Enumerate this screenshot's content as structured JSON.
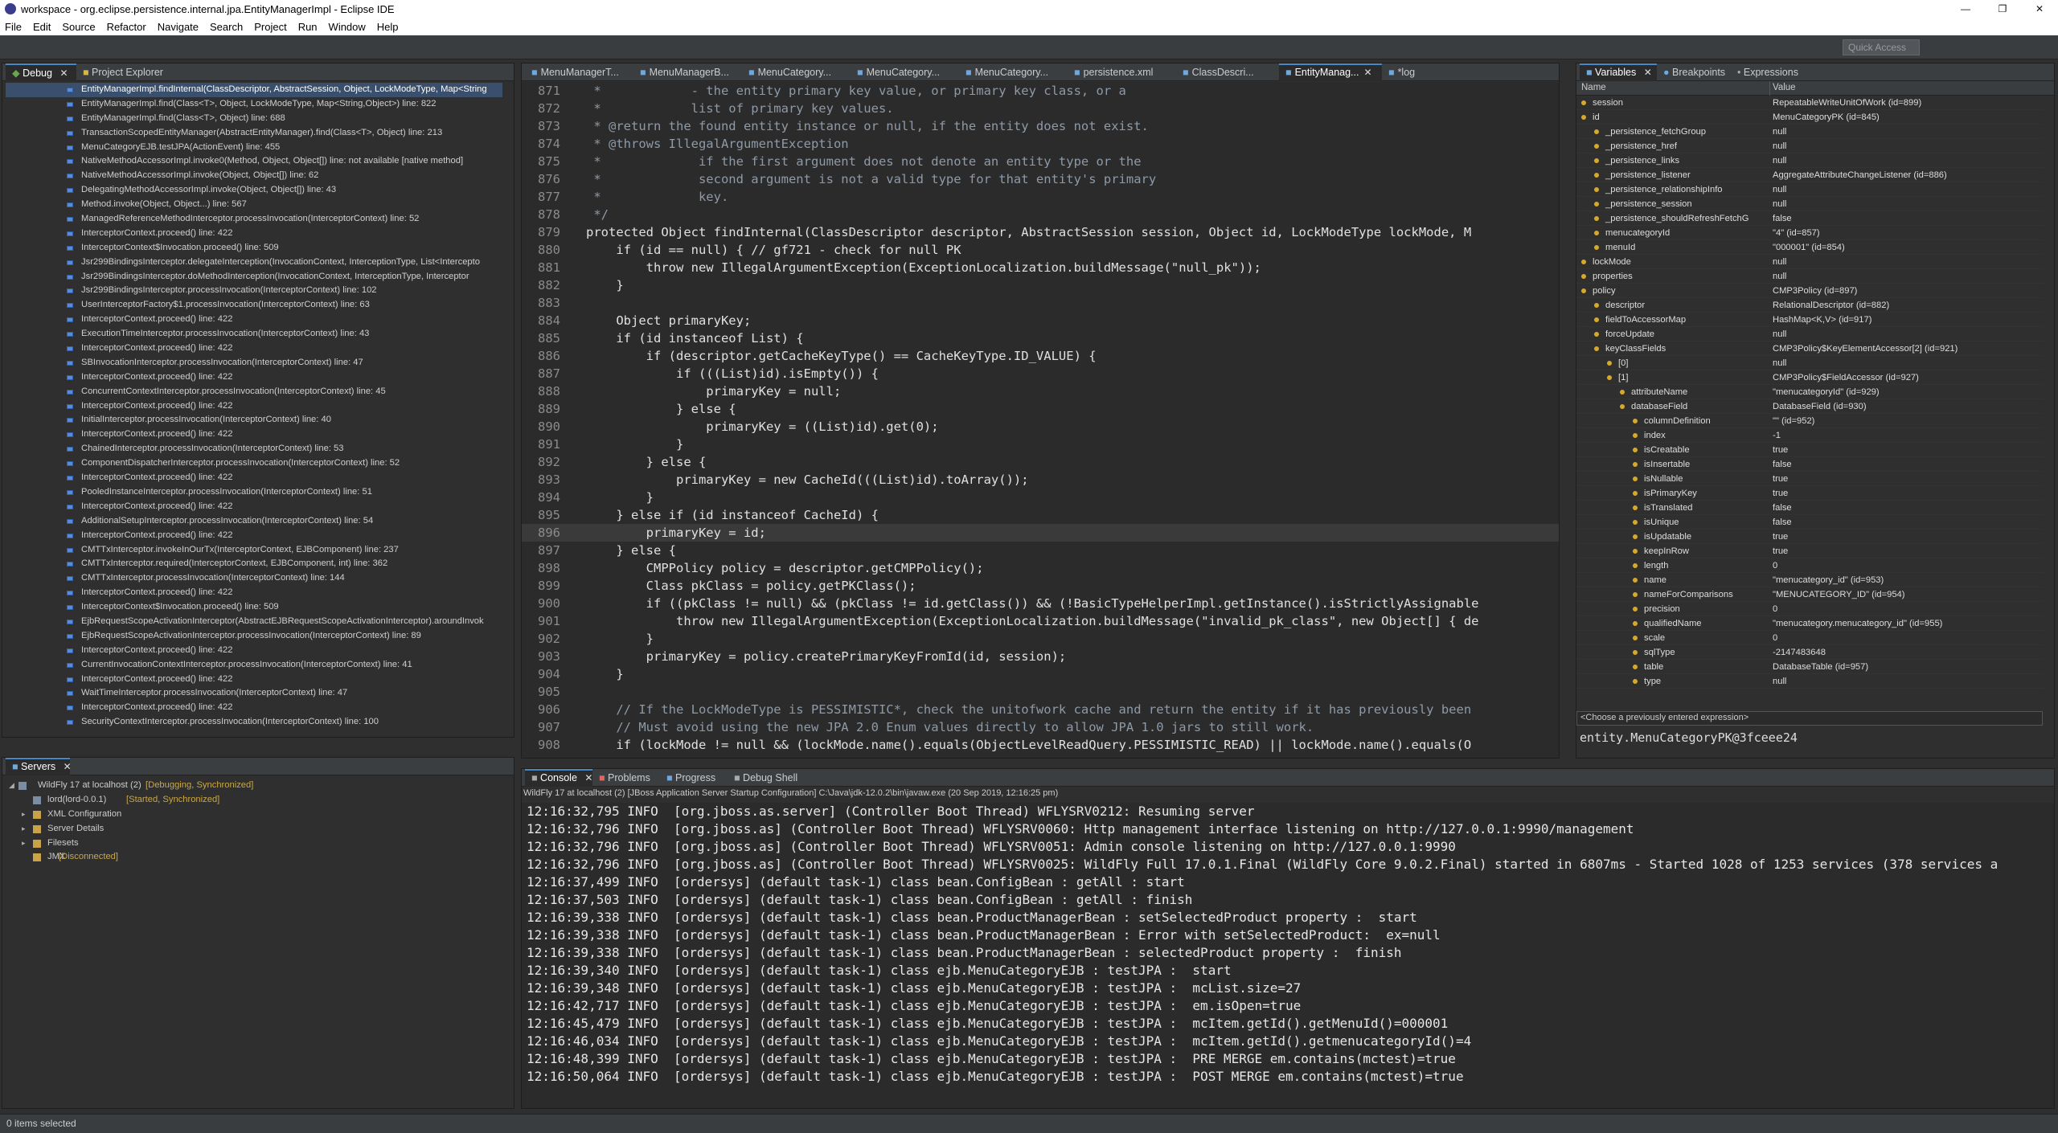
{
  "window": {
    "title": "workspace - org.eclipse.persistence.internal.jpa.EntityManagerImpl - Eclipse IDE"
  },
  "menu": [
    "File",
    "Edit",
    "Source",
    "Refactor",
    "Navigate",
    "Search",
    "Project",
    "Run",
    "Window",
    "Help"
  ],
  "quick_access": "Quick Access",
  "debug_panel": {
    "tabs": [
      "Debug",
      "Project Explorer"
    ],
    "frames": [
      "EntityManagerImpl.findInternal(ClassDescriptor, AbstractSession, Object, LockModeType, Map<String",
      "EntityManagerImpl.find(Class<T>, Object, LockModeType, Map<String,Object>) line: 822",
      "EntityManagerImpl.find(Class<T>, Object) line: 688",
      "TransactionScopedEntityManager(AbstractEntityManager).find(Class<T>, Object) line: 213",
      "MenuCategoryEJB.testJPA(ActionEvent) line: 455",
      "NativeMethodAccessorImpl.invoke0(Method, Object, Object[]) line: not available [native method]",
      "NativeMethodAccessorImpl.invoke(Object, Object[]) line: 62",
      "DelegatingMethodAccessorImpl.invoke(Object, Object[]) line: 43",
      "Method.invoke(Object, Object...) line: 567",
      "ManagedReferenceMethodInterceptor.processInvocation(InterceptorContext) line: 52",
      "InterceptorContext.proceed() line: 422",
      "InterceptorContext$Invocation.proceed() line: 509",
      "Jsr299BindingsInterceptor.delegateInterception(InvocationContext, InterceptionType, List<Intercepto",
      "Jsr299BindingsInterceptor.doMethodInterception(InvocationContext, InterceptionType, Interceptor",
      "Jsr299BindingsInterceptor.processInvocation(InterceptorContext) line: 102",
      "UserInterceptorFactory$1.processInvocation(InterceptorContext) line: 63",
      "InterceptorContext.proceed() line: 422",
      "ExecutionTimeInterceptor.processInvocation(InterceptorContext) line: 43",
      "InterceptorContext.proceed() line: 422",
      "SBInvocationInterceptor.processInvocation(InterceptorContext) line: 47",
      "InterceptorContext.proceed() line: 422",
      "ConcurrentContextInterceptor.processInvocation(InterceptorContext) line: 45",
      "InterceptorContext.proceed() line: 422",
      "InitialInterceptor.processInvocation(InterceptorContext) line: 40",
      "InterceptorContext.proceed() line: 422",
      "ChainedInterceptor.processInvocation(InterceptorContext) line: 53",
      "ComponentDispatcherInterceptor.processInvocation(InterceptorContext) line: 52",
      "InterceptorContext.proceed() line: 422",
      "PooledInstanceInterceptor.processInvocation(InterceptorContext) line: 51",
      "InterceptorContext.proceed() line: 422",
      "AdditionalSetupInterceptor.processInvocation(InterceptorContext) line: 54",
      "InterceptorContext.proceed() line: 422",
      "CMTTxInterceptor.invokeInOurTx(InterceptorContext, EJBComponent) line: 237",
      "CMTTxInterceptor.required(InterceptorContext, EJBComponent, int) line: 362",
      "CMTTxInterceptor.processInvocation(InterceptorContext) line: 144",
      "InterceptorContext.proceed() line: 422",
      "InterceptorContext$Invocation.proceed() line: 509",
      "EjbRequestScopeActivationInterceptor(AbstractEJBRequestScopeActivationInterceptor).aroundInvok",
      "EjbRequestScopeActivationInterceptor.processInvocation(InterceptorContext) line: 89",
      "InterceptorContext.proceed() line: 422",
      "CurrentInvocationContextInterceptor.processInvocation(InterceptorContext) line: 41",
      "InterceptorContext.proceed() line: 422",
      "WaitTimeInterceptor.processInvocation(InterceptorContext) line: 47",
      "InterceptorContext.proceed() line: 422",
      "SecurityContextInterceptor.processInvocation(InterceptorContext) line: 100"
    ]
  },
  "servers_panel": {
    "tab": "Servers",
    "server_name": "WildFly 17 at localhost (2)",
    "server_status": "[Debugging, Synchronized]",
    "nodes": [
      {
        "label": "lord(lord-0.0.1)",
        "status": "[Started, Synchronized]"
      },
      {
        "label": "XML Configuration",
        "status": ""
      },
      {
        "label": "Server Details",
        "status": ""
      },
      {
        "label": "Filesets",
        "status": ""
      },
      {
        "label": "JMX",
        "status": "[Disconnected]"
      }
    ]
  },
  "editor": {
    "tabs": [
      "MenuManagerT...",
      "MenuManagerB...",
      "MenuCategory...",
      "MenuCategory...",
      "MenuCategory...",
      "persistence.xml",
      "ClassDescri...",
      "EntityManag...",
      "*log"
    ],
    "active_tab_index": 7,
    "lines": [
      {
        "n": "871",
        "code": " *            - the entity primary key value, or primary key class, or a",
        "cls": "cmt"
      },
      {
        "n": "872",
        "code": " *            list of primary key values.",
        "cls": "cmt"
      },
      {
        "n": "873",
        "code": " * @return the found entity instance or null, if the entity does not exist.",
        "cls": "cmt"
      },
      {
        "n": "874",
        "code": " * @throws IllegalArgumentException",
        "cls": "cmt"
      },
      {
        "n": "875",
        "code": " *             if the first argument does not denote an entity type or the",
        "cls": "cmt"
      },
      {
        "n": "876",
        "code": " *             second argument is not a valid type for that entity's primary",
        "cls": "cmt"
      },
      {
        "n": "877",
        "code": " *             key.",
        "cls": "cmt"
      },
      {
        "n": "878",
        "code": " */",
        "cls": "cmt"
      },
      {
        "n": "879",
        "code": "protected Object findInternal(ClassDescriptor descriptor, AbstractSession session, Object id, LockModeType lockMode, M",
        "cls": ""
      },
      {
        "n": "880",
        "code": "    if (id == null) { // gf721 - check for null PK",
        "cls": ""
      },
      {
        "n": "881",
        "code": "        throw new IllegalArgumentException(ExceptionLocalization.buildMessage(\"null_pk\"));",
        "cls": ""
      },
      {
        "n": "882",
        "code": "    }",
        "cls": ""
      },
      {
        "n": "883",
        "code": "",
        "cls": ""
      },
      {
        "n": "884",
        "code": "    Object primaryKey;",
        "cls": ""
      },
      {
        "n": "885",
        "code": "    if (id instanceof List) {",
        "cls": ""
      },
      {
        "n": "886",
        "code": "        if (descriptor.getCacheKeyType() == CacheKeyType.ID_VALUE) {",
        "cls": ""
      },
      {
        "n": "887",
        "code": "            if (((List)id).isEmpty()) {",
        "cls": ""
      },
      {
        "n": "888",
        "code": "                primaryKey = null;",
        "cls": ""
      },
      {
        "n": "889",
        "code": "            } else {",
        "cls": ""
      },
      {
        "n": "890",
        "code": "                primaryKey = ((List)id).get(0);",
        "cls": ""
      },
      {
        "n": "891",
        "code": "            }",
        "cls": ""
      },
      {
        "n": "892",
        "code": "        } else {",
        "cls": ""
      },
      {
        "n": "893",
        "code": "            primaryKey = new CacheId(((List)id).toArray());",
        "cls": ""
      },
      {
        "n": "894",
        "code": "        }",
        "cls": ""
      },
      {
        "n": "895",
        "code": "    } else if (id instanceof CacheId) {",
        "cls": ""
      },
      {
        "n": "896",
        "code": "        primaryKey = id;",
        "cls": "hl"
      },
      {
        "n": "897",
        "code": "    } else {",
        "cls": ""
      },
      {
        "n": "898",
        "code": "        CMPPolicy policy = descriptor.getCMPPolicy();",
        "cls": ""
      },
      {
        "n": "899",
        "code": "        Class pkClass = policy.getPKClass();",
        "cls": ""
      },
      {
        "n": "900",
        "code": "        if ((pkClass != null) && (pkClass != id.getClass()) && (!BasicTypeHelperImpl.getInstance().isStrictlyAssignable",
        "cls": ""
      },
      {
        "n": "901",
        "code": "            throw new IllegalArgumentException(ExceptionLocalization.buildMessage(\"invalid_pk_class\", new Object[] { de",
        "cls": ""
      },
      {
        "n": "902",
        "code": "        }",
        "cls": ""
      },
      {
        "n": "903",
        "code": "        primaryKey = policy.createPrimaryKeyFromId(id, session);",
        "cls": ""
      },
      {
        "n": "904",
        "code": "    }",
        "cls": ""
      },
      {
        "n": "905",
        "code": "",
        "cls": ""
      },
      {
        "n": "906",
        "code": "    // If the LockModeType is PESSIMISTIC*, check the unitofwork cache and return the entity if it has previously been",
        "cls": "cmt"
      },
      {
        "n": "907",
        "code": "    // Must avoid using the new JPA 2.0 Enum values directly to allow JPA 1.0 jars to still work.",
        "cls": "cmt"
      },
      {
        "n": "908",
        "code": "    if (lockMode != null && (lockMode.name().equals(ObjectLevelReadQuery.PESSIMISTIC_READ) || lockMode.name().equals(O",
        "cls": ""
      }
    ]
  },
  "variables_panel": {
    "tabs": [
      "Variables",
      "Breakpoints",
      "Expressions"
    ],
    "columns": [
      "Name",
      "Value"
    ],
    "rows": [
      {
        "depth": 0,
        "name": "session",
        "value": "RepeatableWriteUnitOfWork  (id=899)"
      },
      {
        "depth": 0,
        "name": "id",
        "value": "MenuCategoryPK  (id=845)"
      },
      {
        "depth": 1,
        "name": "_persistence_fetchGroup",
        "value": "null"
      },
      {
        "depth": 1,
        "name": "_persistence_href",
        "value": "null"
      },
      {
        "depth": 1,
        "name": "_persistence_links",
        "value": "null"
      },
      {
        "depth": 1,
        "name": "_persistence_listener",
        "value": "AggregateAttributeChangeListener  (id=886)"
      },
      {
        "depth": 1,
        "name": "_persistence_relationshipInfo",
        "value": "null"
      },
      {
        "depth": 1,
        "name": "_persistence_session",
        "value": "null"
      },
      {
        "depth": 1,
        "name": "_persistence_shouldRefreshFetchG",
        "value": "false"
      },
      {
        "depth": 1,
        "name": "menucategoryId",
        "value": "\"4\" (id=857)"
      },
      {
        "depth": 1,
        "name": "menuId",
        "value": "\"000001\" (id=854)"
      },
      {
        "depth": 0,
        "name": "lockMode",
        "value": "null"
      },
      {
        "depth": 0,
        "name": "properties",
        "value": "null"
      },
      {
        "depth": 0,
        "name": "policy",
        "value": "CMP3Policy  (id=897)"
      },
      {
        "depth": 1,
        "name": "descriptor",
        "value": "RelationalDescriptor  (id=882)"
      },
      {
        "depth": 1,
        "name": "fieldToAccessorMap",
        "value": "HashMap<K,V>  (id=917)"
      },
      {
        "depth": 1,
        "name": "forceUpdate",
        "value": "null"
      },
      {
        "depth": 1,
        "name": "keyClassFields",
        "value": "CMP3Policy$KeyElementAccessor[2]  (id=921)"
      },
      {
        "depth": 2,
        "name": "[0]",
        "value": "null"
      },
      {
        "depth": 2,
        "name": "[1]",
        "value": "CMP3Policy$FieldAccessor  (id=927)"
      },
      {
        "depth": 3,
        "name": "attributeName",
        "value": "\"menucategoryId\" (id=929)"
      },
      {
        "depth": 3,
        "name": "databaseField",
        "value": "DatabaseField  (id=930)"
      },
      {
        "depth": 4,
        "name": "columnDefinition",
        "value": "\"\" (id=952)"
      },
      {
        "depth": 4,
        "name": "index",
        "value": "-1"
      },
      {
        "depth": 4,
        "name": "isCreatable",
        "value": "true"
      },
      {
        "depth": 4,
        "name": "isInsertable",
        "value": "false"
      },
      {
        "depth": 4,
        "name": "isNullable",
        "value": "true"
      },
      {
        "depth": 4,
        "name": "isPrimaryKey",
        "value": "true"
      },
      {
        "depth": 4,
        "name": "isTranslated",
        "value": "false"
      },
      {
        "depth": 4,
        "name": "isUnique",
        "value": "false"
      },
      {
        "depth": 4,
        "name": "isUpdatable",
        "value": "true"
      },
      {
        "depth": 4,
        "name": "keepInRow",
        "value": "true"
      },
      {
        "depth": 4,
        "name": "length",
        "value": "0"
      },
      {
        "depth": 4,
        "name": "name",
        "value": "\"menucategory_id\" (id=953)"
      },
      {
        "depth": 4,
        "name": "nameForComparisons",
        "value": "\"MENUCATEGORY_ID\" (id=954)"
      },
      {
        "depth": 4,
        "name": "precision",
        "value": "0"
      },
      {
        "depth": 4,
        "name": "qualifiedName",
        "value": "\"menucategory.menucategory_id\" (id=955)"
      },
      {
        "depth": 4,
        "name": "scale",
        "value": "0"
      },
      {
        "depth": 4,
        "name": "sqlType",
        "value": "-2147483648"
      },
      {
        "depth": 4,
        "name": "table",
        "value": "DatabaseTable  (id=957)"
      },
      {
        "depth": 4,
        "name": "type",
        "value": "null"
      }
    ],
    "expression_placeholder": "<Choose a previously entered expression>",
    "detail_value": "entity.MenuCategoryPK@3fceee24"
  },
  "console_panel": {
    "tabs": [
      "Console",
      "Problems",
      "Progress",
      "Debug Shell"
    ],
    "process": "WildFly 17 at localhost (2) [JBoss Application Server Startup Configuration] C:\\Java\\jdk-12.0.2\\bin\\javaw.exe (20 Sep 2019, 12:16:25 pm)",
    "lines": [
      "12:16:32,795 INFO  [org.jboss.as.server] (Controller Boot Thread) WFLYSRV0212: Resuming server",
      "12:16:32,796 INFO  [org.jboss.as] (Controller Boot Thread) WFLYSRV0060: Http management interface listening on http://127.0.0.1:9990/management",
      "12:16:32,796 INFO  [org.jboss.as] (Controller Boot Thread) WFLYSRV0051: Admin console listening on http://127.0.0.1:9990",
      "12:16:32,796 INFO  [org.jboss.as] (Controller Boot Thread) WFLYSRV0025: WildFly Full 17.0.1.Final (WildFly Core 9.0.2.Final) started in 6807ms - Started 1028 of 1253 services (378 services a",
      "12:16:37,499 INFO  [ordersys] (default task-1) class bean.ConfigBean : getAll : start",
      "12:16:37,503 INFO  [ordersys] (default task-1) class bean.ConfigBean : getAll : finish",
      "12:16:39,338 INFO  [ordersys] (default task-1) class bean.ProductManagerBean : setSelectedProduct property :  start",
      "12:16:39,338 INFO  [ordersys] (default task-1) class bean.ProductManagerBean : Error with setSelectedProduct:  ex=null",
      "12:16:39,338 INFO  [ordersys] (default task-1) class bean.ProductManagerBean : selectedProduct property :  finish",
      "12:16:39,340 INFO  [ordersys] (default task-1) class ejb.MenuCategoryEJB : testJPA :  start",
      "12:16:39,348 INFO  [ordersys] (default task-1) class ejb.MenuCategoryEJB : testJPA :  mcList.size=27",
      "12:16:42,717 INFO  [ordersys] (default task-1) class ejb.MenuCategoryEJB : testJPA :  em.isOpen=true",
      "12:16:45,479 INFO  [ordersys] (default task-1) class ejb.MenuCategoryEJB : testJPA :  mcItem.getId().getMenuId()=000001",
      "12:16:46,034 INFO  [ordersys] (default task-1) class ejb.MenuCategoryEJB : testJPA :  mcItem.getId().getmenucategoryId()=4",
      "12:16:48,399 INFO  [ordersys] (default task-1) class ejb.MenuCategoryEJB : testJPA :  PRE MERGE em.contains(mctest)=true",
      "12:16:50,064 INFO  [ordersys] (default task-1) class ejb.MenuCategoryEJB : testJPA :  POST MERGE em.contains(mctest)=true"
    ]
  },
  "status_bar": {
    "text": "0 items selected"
  }
}
